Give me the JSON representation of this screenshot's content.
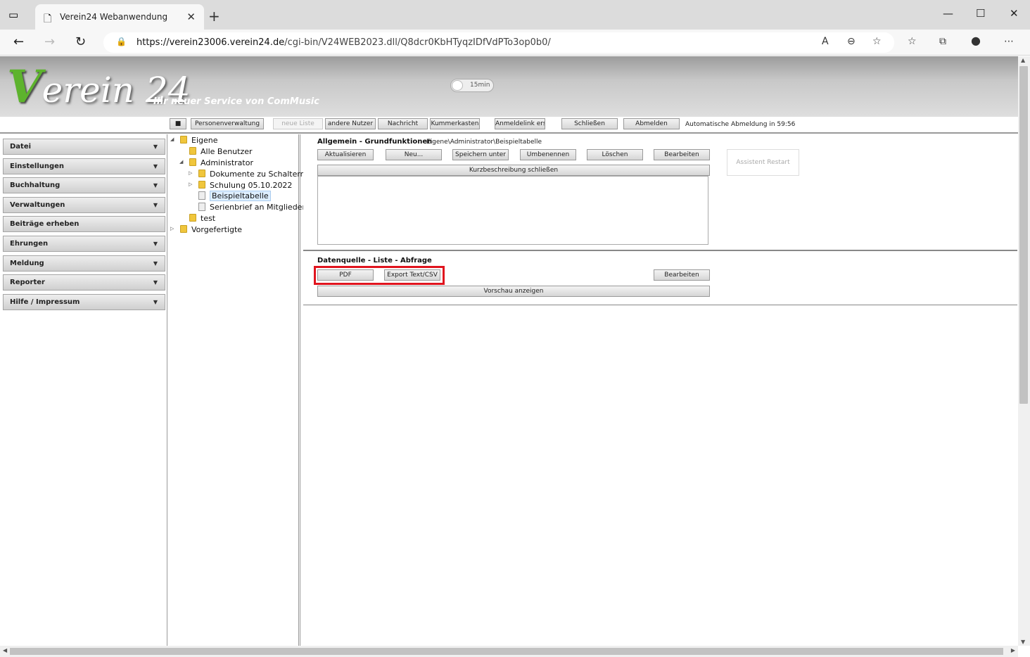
{
  "browser": {
    "tab_title": "Verein24 Webanwendung",
    "url_host": "https://verein23006.verein24.de",
    "url_path": "/cgi-bin/V24WEB2023.dll/Q8dcr0KbHTyqzIDfVdPTo3op0b0/"
  },
  "header": {
    "logo_v": "V",
    "logo_rest": "erein 24",
    "slogan": "Ihr neuer Service von ComMusic",
    "timer_label": "15min"
  },
  "toolbar": {
    "square_label": "■",
    "personen": "Personenverwaltung",
    "neue_liste": "neue Liste",
    "andere_nutzer": "andere Nutzer",
    "nachricht": "Nachricht",
    "kummerkasten": "Kummerkasten",
    "anmeldelink": "Anmeldelink erst",
    "schliessen": "Schließen",
    "abmelden": "Abmelden",
    "autologout": "Automatische Abmeldung in 59:56"
  },
  "sidebar": {
    "items": [
      {
        "label": "Datei"
      },
      {
        "label": "Einstellungen"
      },
      {
        "label": "Buchhaltung"
      },
      {
        "label": "Verwaltungen"
      },
      {
        "label": "Beiträge erheben"
      },
      {
        "label": "Ehrungen"
      },
      {
        "label": "Meldung"
      },
      {
        "label": "Reporter"
      },
      {
        "label": "Hilfe / Impressum"
      }
    ]
  },
  "tree": {
    "eigene": "Eigene",
    "alle_benutzer": "Alle Benutzer",
    "administrator": "Administrator",
    "dokumente": "Dokumente zu Schaltern",
    "schulung": "Schulung 05.10.2022",
    "beispieltabelle": "Beispieltabelle",
    "serienbrief": "Serienbrief an Mitglieder",
    "test": "test",
    "vorgefertigte": "Vorgefertigte"
  },
  "allgemein": {
    "title": "Allgemein - Grundfunktionen",
    "path": "Eigene\\Administrator\\Beispieltabelle",
    "aktualisieren": "Aktualisieren",
    "neu": "Neu...",
    "speichern_unter": "Speichern unter",
    "umbenennen": "Umbenennen",
    "loeschen": "Löschen",
    "bearbeiten": "Bearbeiten",
    "kurzbeschreibung": "Kurzbeschreibung schließen",
    "assistent": "Assistent Restart"
  },
  "datenquelle": {
    "title": "Datenquelle - Liste - Abfrage",
    "pdf": "PDF",
    "export": "Export Text/CSV",
    "bearbeiten": "Bearbeiten",
    "vorschau": "Vorschau anzeigen"
  }
}
